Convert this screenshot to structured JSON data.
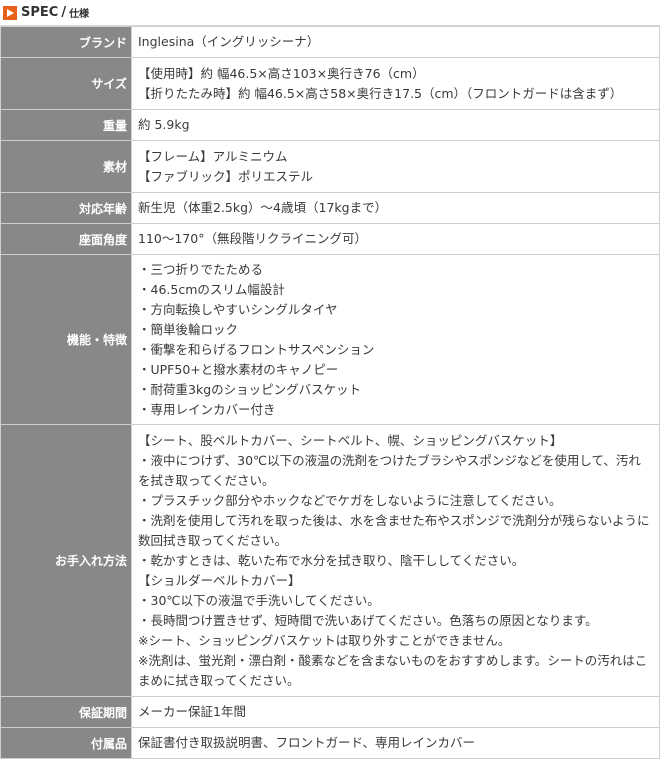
{
  "header": {
    "title": "SPEC",
    "separator": "/",
    "subtitle": "仕様",
    "icon": "orange-arrow-icon",
    "accent_color": "#e8611a"
  },
  "colors": {
    "label_bg": "#888888",
    "label_text": "#ffffff",
    "border": "#cfcfcf"
  },
  "rows": [
    {
      "label": "ブランド",
      "lines": [
        "Inglesina（イングリッシーナ）"
      ]
    },
    {
      "label": "サイズ",
      "lines": [
        "【使用時】約 幅46.5×高さ103×奥行き76（cm）",
        "【折りたたみ時】約 幅46.5×高さ58×奥行き17.5（cm）（フロントガードは含まず）"
      ]
    },
    {
      "label": "重量",
      "lines": [
        "約 5.9kg"
      ]
    },
    {
      "label": "素材",
      "lines": [
        "【フレーム】アルミニウム",
        "【ファブリック】ポリエステル"
      ]
    },
    {
      "label": "対応年齢",
      "lines": [
        "新生児（体重2.5kg）～4歳頃（17kgまで）"
      ]
    },
    {
      "label": "座面角度",
      "lines": [
        "110～170°（無段階リクライニング可）"
      ]
    },
    {
      "label": "機能・特徴",
      "lines": [
        "・三つ折りでたためる",
        "・46.5cmのスリム幅設計",
        "・方向転換しやすいシングルタイヤ",
        "・簡単後輪ロック",
        "・衝撃を和らげるフロントサスペンション",
        "・UPF50+と撥水素材のキャノピー",
        "・耐荷重3kgのショッピングバスケット",
        "・専用レインカバー付き"
      ]
    },
    {
      "label": "お手入れ方法",
      "lines": [
        "【シート、股ベルトカバー、シートベルト、幌、ショッピングバスケット】",
        "・液中につけず、30℃以下の液温の洗剤をつけたブラシやスポンジなどを使用して、汚れを拭き取ってください。",
        "・プラスチック部分やホックなどでケガをしないように注意してください。",
        "・洗剤を使用して汚れを取った後は、水を含ませた布やスポンジで洗剤分が残らないように数回拭き取ってください。",
        "・乾かすときは、乾いた布で水分を拭き取り、陰干ししてください。",
        "【ショルダーベルトカバー】",
        "・30℃以下の液温で手洗いしてください。",
        "・長時間つけ置きせず、短時間で洗いあげてください。色落ちの原因となります。",
        "※シート、ショッピングバスケットは取り外すことができません。",
        "※洗剤は、蛍光剤・漂白剤・酸素などを含まないものをおすすめします。シートの汚れはこまめに拭き取ってください。"
      ]
    },
    {
      "label": "保証期間",
      "lines": [
        "メーカー保証1年間"
      ]
    },
    {
      "label": "付属品",
      "lines": [
        "保証書付き取扱説明書、フロントガード、専用レインカバー"
      ]
    }
  ]
}
